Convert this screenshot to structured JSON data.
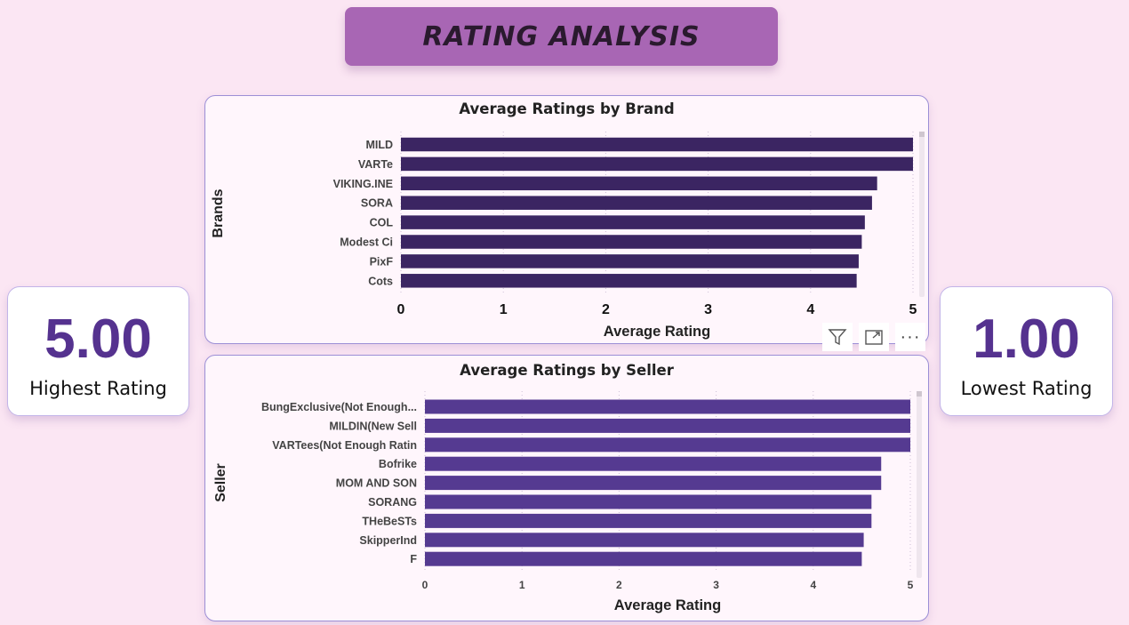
{
  "banner": {
    "title": "RATING ANALYSIS"
  },
  "kpis": {
    "highest": {
      "value": "5.00",
      "label": "Highest Rating"
    },
    "lowest": {
      "value": "1.00",
      "label": "Lowest Rating"
    }
  },
  "colors": {
    "brand_bar": "#3b2562",
    "seller_bar": "#553a91",
    "kpi_value": "#55328f",
    "banner": "#a866b4"
  },
  "toolbar": {
    "icons": [
      "filter-icon",
      "focus-mode-icon",
      "more-options-icon"
    ],
    "more_label": "···"
  },
  "chart_data": [
    {
      "type": "bar",
      "orientation": "horizontal",
      "title": "Average Ratings by Brand",
      "xlabel": "Average Rating",
      "ylabel": "Brands",
      "categories": [
        "MILD",
        "VARTe",
        "VIKING.INE",
        "SORA",
        "COL",
        "Modest Ci",
        "PixF",
        "Cots"
      ],
      "values": [
        5.0,
        5.0,
        4.65,
        4.6,
        4.53,
        4.5,
        4.47,
        4.45
      ],
      "xticks": [
        "0",
        "1",
        "2",
        "3",
        "4",
        "5"
      ],
      "xlim": [
        0,
        5
      ],
      "grid": true
    },
    {
      "type": "bar",
      "orientation": "horizontal",
      "title": "Average Ratings by Seller",
      "xlabel": "Average Rating",
      "ylabel": "Seller",
      "categories": [
        "BungExclusive(Not Enough...",
        "MILDIN(New Sell",
        "VARTees(Not Enough Ratin",
        "Bofrike",
        "MOM AND SON",
        "SORANG",
        "THeBeSTs",
        "SkipperInd",
        "F"
      ],
      "values": [
        5.0,
        5.0,
        5.0,
        4.7,
        4.7,
        4.6,
        4.6,
        4.52,
        4.5
      ],
      "xticks": [
        "0",
        "1",
        "2",
        "3",
        "4",
        "5"
      ],
      "xlim": [
        0,
        5
      ],
      "grid": true
    }
  ]
}
